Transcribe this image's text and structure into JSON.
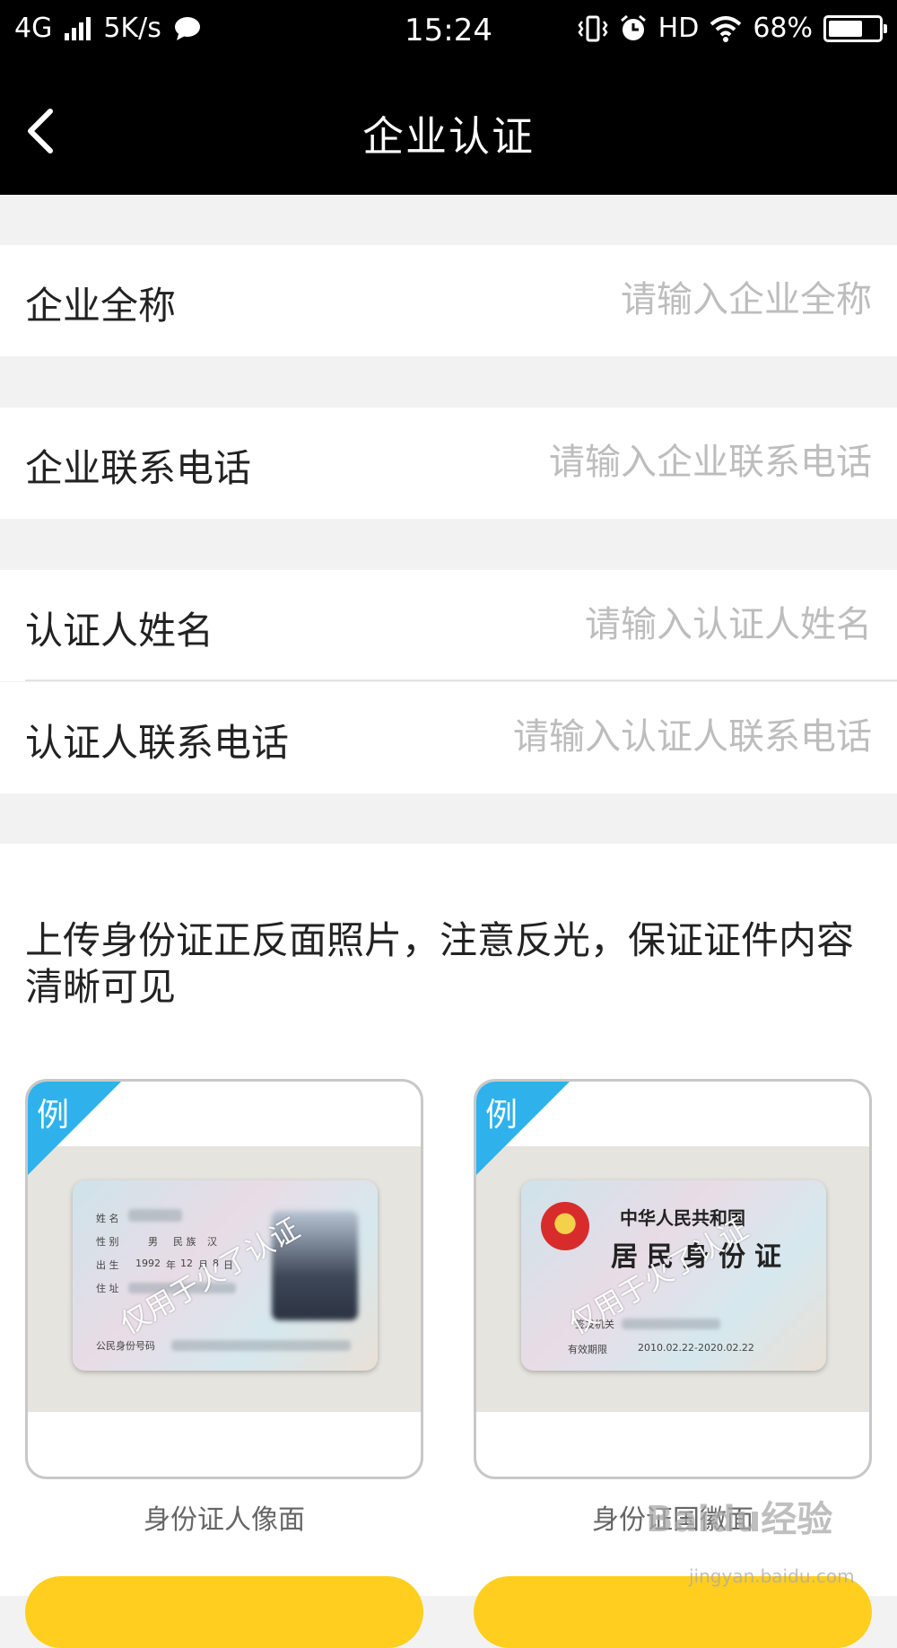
{
  "status_bar": {
    "network": "4G",
    "speed": "5K/s",
    "time": "15:24",
    "hd": "HD",
    "battery": "68%",
    "battery_level": 0.68
  },
  "navbar": {
    "title": "企业认证"
  },
  "fields": [
    {
      "label": "企业全称",
      "placeholder": "请输入企业全称",
      "value": ""
    },
    {
      "label": "企业联系电话",
      "placeholder": "请输入企业联系电话",
      "value": ""
    },
    {
      "label": "认证人姓名",
      "placeholder": "请输入认证人姓名",
      "value": ""
    },
    {
      "label": "认证人联系电话",
      "placeholder": "请输入认证人联系电话",
      "value": ""
    }
  ],
  "upload": {
    "hint": "上传身份证正反面照片，注意反光，保证证件内容清晰可见",
    "cards": [
      {
        "corner": "例",
        "caption": "身份证人像面",
        "watermark": "仅用于火了认证",
        "texts": {
          "name": "姓 名",
          "gender": "性 别",
          "gender_value": "男",
          "ethnicity": "民 族",
          "ethnicity_value": "汉",
          "birth": "出 生",
          "birth_year": "1992",
          "birth_month_label": "年",
          "birth_month": "12",
          "birth_day_label": "月",
          "birth_day": "8",
          "birth_day_suffix": "日",
          "address": "住 址",
          "id_number": "公民身份号码"
        }
      },
      {
        "corner": "例",
        "caption": "身份证国徽面",
        "watermark": "仅用于火了认证",
        "texts": {
          "country": "中华人民共和国",
          "card_title": "居民身份证",
          "authority": "签发机关",
          "validity_label": "有效期限",
          "validity": "2010.02.22-2020.02.22"
        }
      }
    ]
  },
  "site_watermark": {
    "logo": "Baidu经验",
    "url": "jingyan.baidu.com"
  }
}
